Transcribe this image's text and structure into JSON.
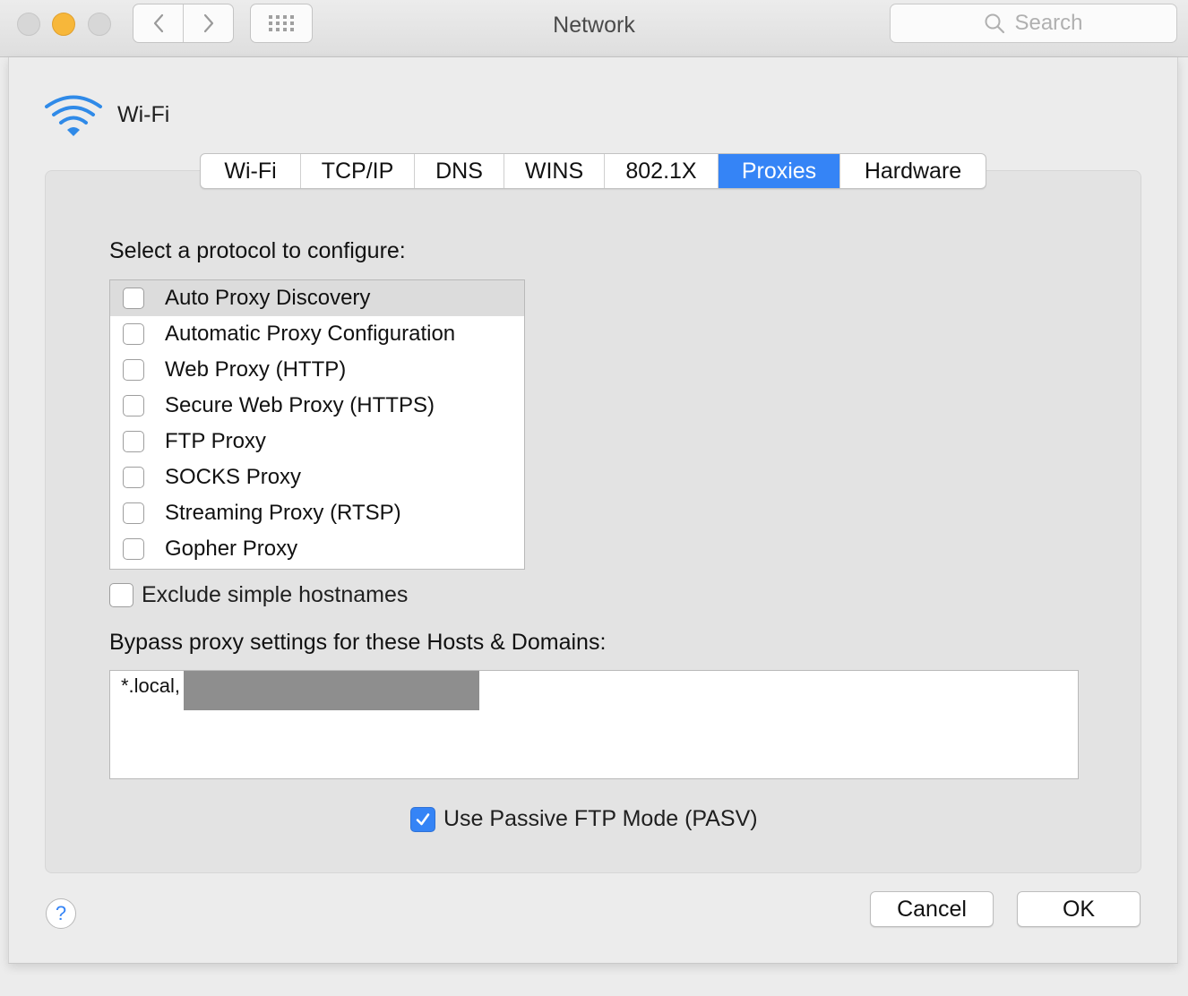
{
  "window": {
    "title": "Network"
  },
  "search": {
    "placeholder": "Search"
  },
  "interface": {
    "name": "Wi-Fi",
    "icon": "wifi-icon"
  },
  "tabs": [
    {
      "label": "Wi-Fi",
      "active": false
    },
    {
      "label": "TCP/IP",
      "active": false
    },
    {
      "label": "DNS",
      "active": false
    },
    {
      "label": "WINS",
      "active": false
    },
    {
      "label": "802.1X",
      "active": false
    },
    {
      "label": "Proxies",
      "active": true
    },
    {
      "label": "Hardware",
      "active": false
    }
  ],
  "proxies": {
    "select_label": "Select a protocol to configure:",
    "protocols": [
      {
        "label": "Auto Proxy Discovery",
        "checked": false,
        "selected": true
      },
      {
        "label": "Automatic Proxy Configuration",
        "checked": false,
        "selected": false
      },
      {
        "label": "Web Proxy (HTTP)",
        "checked": false,
        "selected": false
      },
      {
        "label": "Secure Web Proxy (HTTPS)",
        "checked": false,
        "selected": false
      },
      {
        "label": "FTP Proxy",
        "checked": false,
        "selected": false
      },
      {
        "label": "SOCKS Proxy",
        "checked": false,
        "selected": false
      },
      {
        "label": "Streaming Proxy (RTSP)",
        "checked": false,
        "selected": false
      },
      {
        "label": "Gopher Proxy",
        "checked": false,
        "selected": false
      }
    ],
    "exclude_simple": {
      "label": "Exclude simple hostnames",
      "checked": false
    },
    "bypass_label": "Bypass proxy settings for these Hosts & Domains:",
    "bypass_value": "*.local,",
    "passive_ftp": {
      "label": "Use Passive FTP Mode (PASV)",
      "checked": true
    }
  },
  "buttons": {
    "help": "?",
    "cancel": "Cancel",
    "ok": "OK"
  },
  "colors": {
    "accent": "#3584f6",
    "minimize": "#f7b73a",
    "panel": "#e3e3e3",
    "window": "#ececec"
  }
}
